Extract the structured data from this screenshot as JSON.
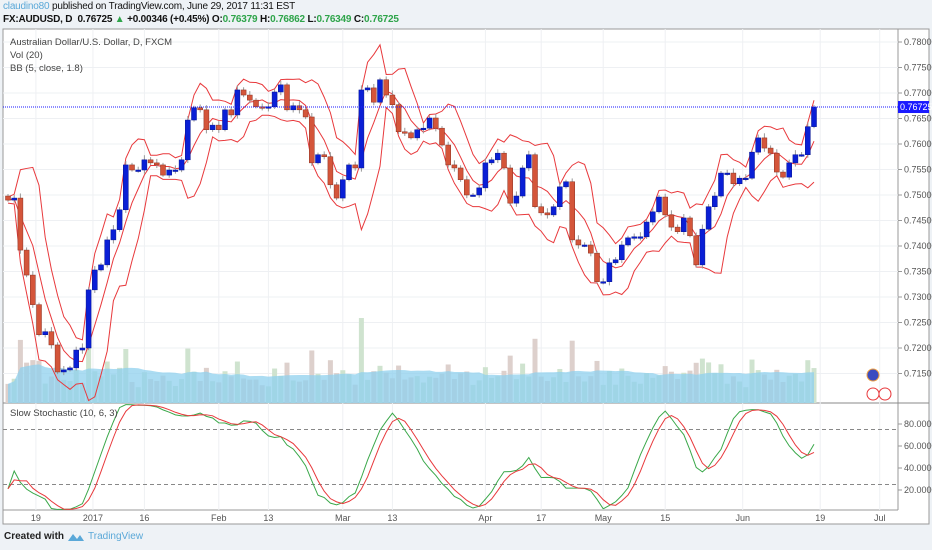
{
  "header": {
    "user": "claudino80",
    "published": "published on TradingView.com, June 29, 2017 11:31 EST",
    "symbol": "FX:AUDUSD, D",
    "last": "0.76725",
    "change_arrow": "▲",
    "change": "+0.00346 (+0.45%)",
    "o_label": "O:",
    "o": "0.76379",
    "h_label": "H:",
    "h": "0.76862",
    "l_label": "L:",
    "l": "0.76349",
    "c_label": "C:",
    "c": "0.76725"
  },
  "legends": {
    "main": "Australian Dollar/U.S. Dollar, D, FXCM",
    "vol": "Vol (20)",
    "bb": "BB (5, close, 1.8)",
    "stoch": "Slow Stochastic (10, 6, 3)"
  },
  "footer": {
    "created_with": "Created with",
    "brand": "TradingView"
  },
  "colors": {
    "up": "#0a1fd6",
    "down": "#d4553a",
    "bb": "#e8393c",
    "stoch_k": "#3aa84a",
    "stoch_d": "#e8393c",
    "vol_ma": "#8fd0ee",
    "last_price": "#1a1aff"
  },
  "chart_data": [
    {
      "type": "candlestick",
      "title": "Australian Dollar/U.S. Dollar, D, FXCM",
      "ylim": [
        0.7125,
        0.7825
      ],
      "yticks": [
        "0.78000",
        "0.77500",
        "0.77000",
        "0.76500",
        "0.76000",
        "0.75500",
        "0.75000",
        "0.74500",
        "0.74000",
        "0.73500",
        "0.73000",
        "0.72500",
        "0.72000",
        "0.71500"
      ],
      "last_price_label": "0.76725",
      "xticks": [
        {
          "label": "19",
          "bar": 4.5
        },
        {
          "label": "2017",
          "bar": 13.7
        },
        {
          "label": "16",
          "bar": 22
        },
        {
          "label": "Feb",
          "bar": 34
        },
        {
          "label": "13",
          "bar": 42
        },
        {
          "label": "Mar",
          "bar": 54
        },
        {
          "label": "13",
          "bar": 62
        },
        {
          "label": "Apr",
          "bar": 77
        },
        {
          "label": "17",
          "bar": 86
        },
        {
          "label": "May",
          "bar": 96
        },
        {
          "label": "15",
          "bar": 106
        },
        {
          "label": "Jun",
          "bar": 118.5
        },
        {
          "label": "19",
          "bar": 131
        },
        {
          "label": "Jul",
          "bar": 140.6
        }
      ],
      "close": [
        0.749,
        0.7494,
        0.7392,
        0.7343,
        0.7285,
        0.7226,
        0.7232,
        0.7206,
        0.7153,
        0.7157,
        0.7161,
        0.7196,
        0.72,
        0.7314,
        0.7353,
        0.7363,
        0.7412,
        0.7432,
        0.7471,
        0.7559,
        0.7549,
        0.7549,
        0.7569,
        0.7563,
        0.7559,
        0.7539,
        0.7549,
        0.7549,
        0.7569,
        0.7647,
        0.7671,
        0.7667,
        0.7628,
        0.7637,
        0.7628,
        0.7667,
        0.7657,
        0.7706,
        0.7696,
        0.7686,
        0.7673,
        0.7671,
        0.7673,
        0.7702,
        0.7716,
        0.7667,
        0.7675,
        0.7667,
        0.7653,
        0.7563,
        0.7579,
        0.7575,
        0.752,
        0.7494,
        0.753,
        0.7559,
        0.7553,
        0.7706,
        0.771,
        0.7682,
        0.7726,
        0.7696,
        0.7677,
        0.7624,
        0.7622,
        0.7612,
        0.7628,
        0.7631,
        0.7651,
        0.7631,
        0.7598,
        0.7559,
        0.7553,
        0.753,
        0.75,
        0.75,
        0.7514,
        0.7563,
        0.7569,
        0.7582,
        0.7553,
        0.7484,
        0.7498,
        0.7553,
        0.7579,
        0.7477,
        0.7465,
        0.7461,
        0.7477,
        0.7516,
        0.7526,
        0.7412,
        0.7402,
        0.7402,
        0.7386,
        0.733,
        0.733,
        0.7367,
        0.7373,
        0.7402,
        0.7416,
        0.7418,
        0.7418,
        0.7447,
        0.7467,
        0.7496,
        0.7461,
        0.7437,
        0.7428,
        0.7455,
        0.742,
        0.7363,
        0.7433,
        0.7477,
        0.7498,
        0.7543,
        0.7543,
        0.7522,
        0.7533,
        0.7533,
        0.7584,
        0.7612,
        0.7592,
        0.7582,
        0.7545,
        0.7535,
        0.7563,
        0.7579,
        0.7579,
        0.7634,
        0.76725
      ]
    },
    {
      "type": "line",
      "title": "Slow Stochastic (10, 6, 3)",
      "ylim": [
        0,
        100
      ],
      "yticks": [
        "80.0000",
        "60.0000",
        "40.0000",
        "20.0000"
      ],
      "bands": [
        75,
        25
      ]
    }
  ]
}
